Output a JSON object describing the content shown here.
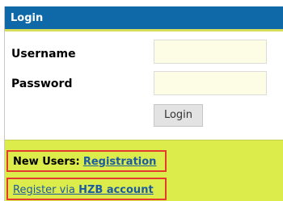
{
  "login_panel": {
    "title": "Login",
    "username_label": "Username",
    "username_value": "",
    "password_label": "Password",
    "password_value": "",
    "login_button_label": "Login"
  },
  "new_users": {
    "prefix": "New Users:",
    "registration_link": "Registration",
    "register_via_text": "Register via",
    "hzb_account_text": "HZB account"
  },
  "colors": {
    "header_bg": "#0f69a8",
    "accent_band": "#dcec4a",
    "input_bg": "#fdfde6",
    "highlight_border": "#e33b2d",
    "link": "#1b5ba3"
  }
}
